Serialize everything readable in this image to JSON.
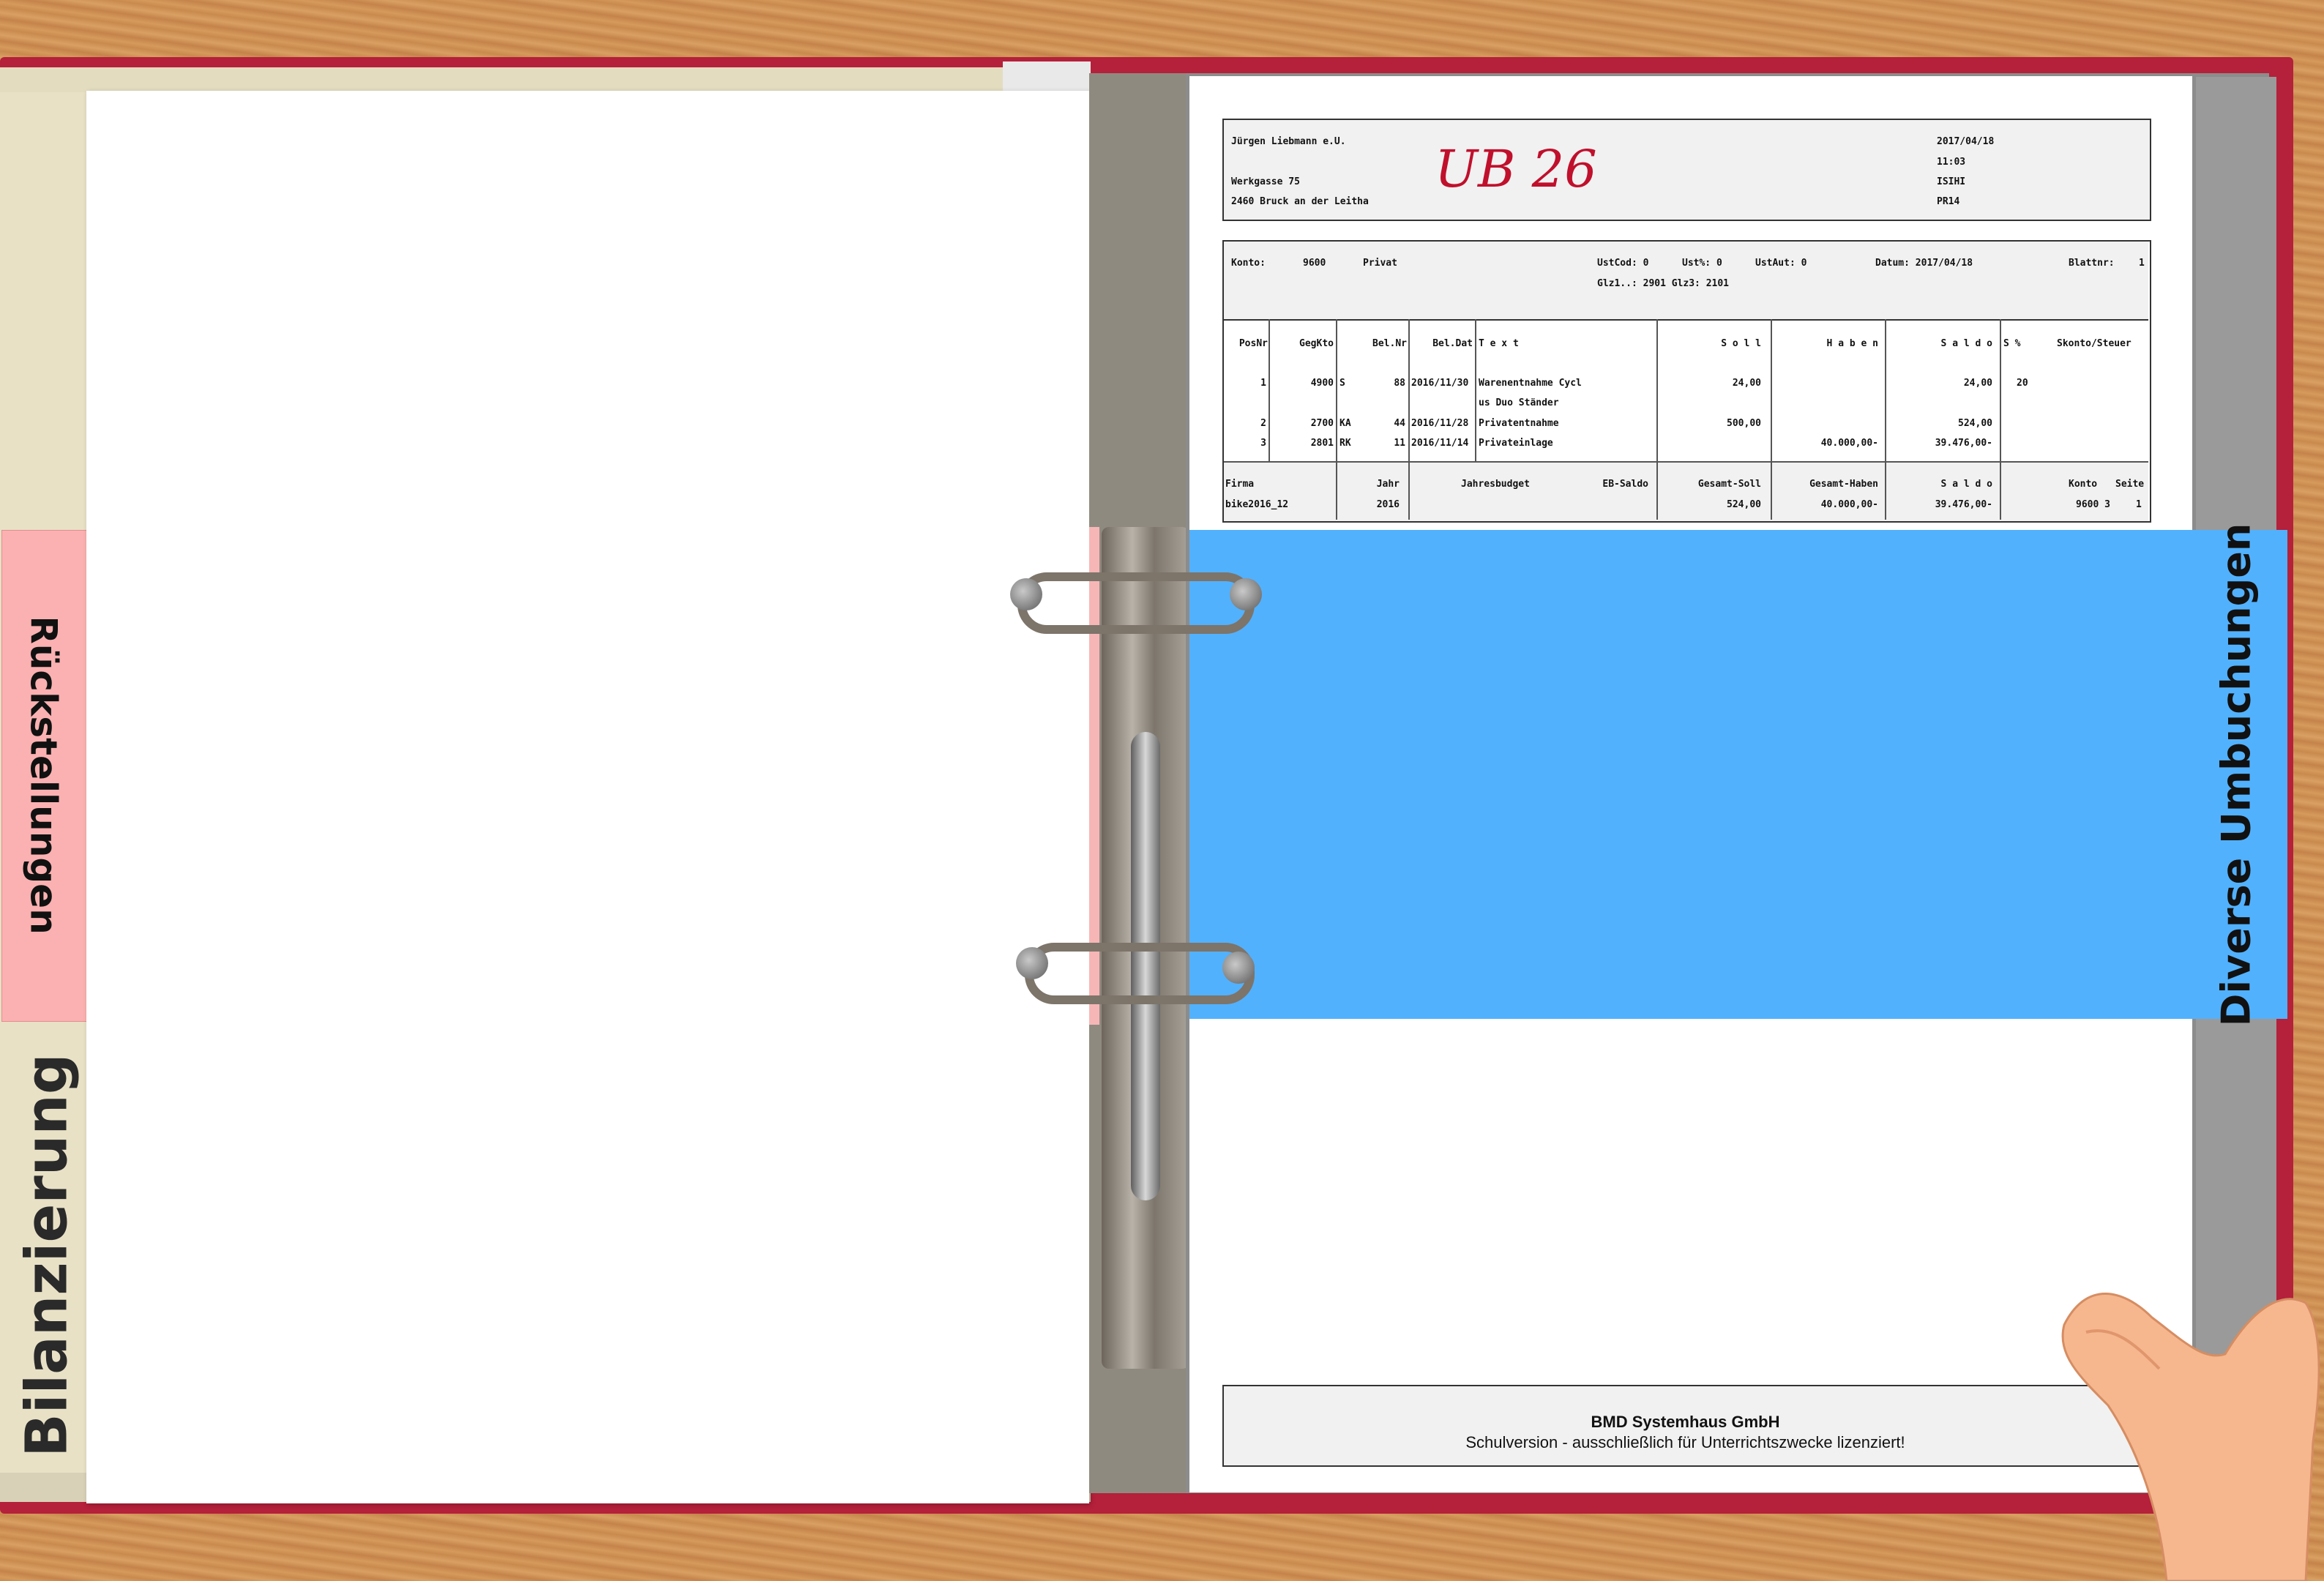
{
  "binder": {
    "left_tab_label": "Rückstellungen",
    "spine_label": "Bilanzierung",
    "right_tab_label": "Diverse Umbuchungen",
    "cover_color": "#b5203a",
    "right_tab_color": "#52b1fd",
    "left_tab_color": "#fbb1b1"
  },
  "document": {
    "stamp": "UB 26",
    "header": {
      "company": "Jürgen Liebmann e.U.",
      "street": "Werkgasse 75",
      "city": "2460 Bruck an der Leitha",
      "date": "2017/04/18",
      "time": "11:03",
      "user": "ISIHI",
      "program": "PR14"
    },
    "account": {
      "konto_label": "Konto:",
      "konto_value": "9600",
      "konto_name": "Privat",
      "ustcod": "UstCod:  0",
      "ustpct": "Ust%:  0",
      "ustaut": "UstAut: 0",
      "datum": "Datum: 2017/04/18",
      "blattnr_label": "Blattnr:",
      "blattnr_value": "1",
      "glz": "Glz1..: 2901  Glz3: 2101"
    },
    "columns": [
      "PosNr",
      "GegKto",
      "Bel.Nr",
      "Bel.Dat",
      "T e x t",
      "S o l l",
      "H a b e n",
      "S a l d o",
      "S  %",
      "Skonto/Steuer"
    ],
    "rows": [
      {
        "pos": "1",
        "gegkto": "4900",
        "bel_type": "S",
        "belnr": "88",
        "beldat": "2016/11/30",
        "text": "Warenentnahme Cycl",
        "soll": "24,00",
        "haben": "",
        "saldo": "24,00",
        "pct": "20"
      },
      {
        "pos": "",
        "gegkto": "",
        "bel_type": "",
        "belnr": "",
        "beldat": "",
        "text": "us Duo Ständer",
        "soll": "",
        "haben": "",
        "saldo": "",
        "pct": ""
      },
      {
        "pos": "2",
        "gegkto": "2700",
        "bel_type": "KA",
        "belnr": "44",
        "beldat": "2016/11/28",
        "text": "Privatentnahme",
        "soll": "500,00",
        "haben": "",
        "saldo": "524,00",
        "pct": ""
      },
      {
        "pos": "3",
        "gegkto": "2801",
        "bel_type": "RK",
        "belnr": "11",
        "beldat": "2016/11/14",
        "text": "Privateinlage",
        "soll": "",
        "haben": "40.000,00-",
        "saldo": "39.476,00-",
        "pct": ""
      }
    ],
    "footer_table": {
      "headers": [
        "Firma",
        "Jahr",
        "Jahresbudget",
        "EB-Saldo",
        "Gesamt-Soll",
        "Gesamt-Haben",
        "S a l d o",
        "Konto",
        "Seite"
      ],
      "values": [
        "bike2016_12",
        "2016",
        "",
        "",
        "524,00",
        "40.000,00-",
        "39.476,00-",
        "9600  3",
        "1"
      ]
    },
    "footer": {
      "company": "BMD Systemhaus GmbH",
      "note": "Schulversion - ausschließlich für Unterrichtszwecke lizenziert!"
    }
  }
}
